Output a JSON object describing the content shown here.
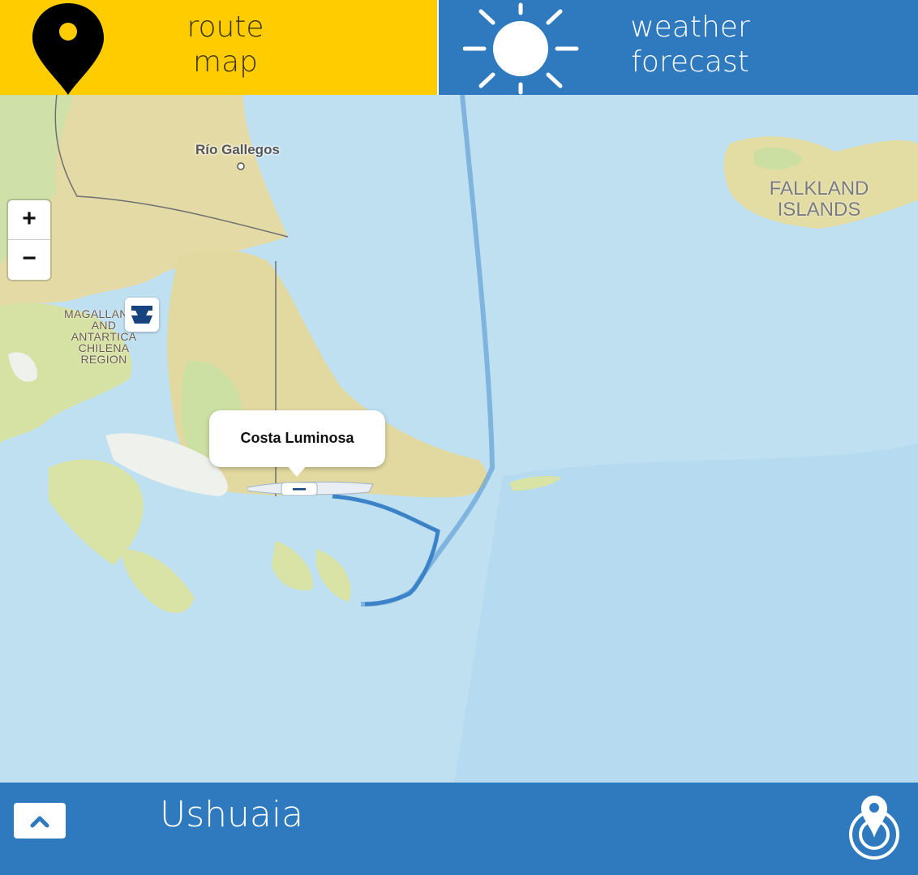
{
  "header": {
    "route_tab": {
      "line1": "route",
      "line2": "map",
      "icon": "map-pin-icon",
      "color": "#FFCC00"
    },
    "weather_tab": {
      "line1": "weather",
      "line2": "forecast",
      "icon": "sun-icon",
      "color": "#2F7ABF"
    }
  },
  "map": {
    "zoom_in": "+",
    "zoom_out": "−",
    "labels": {
      "rio_gallegos": "Río Gallegos",
      "region": [
        "MAGALLANES",
        "AND",
        "ANTARTICA",
        "CHILENA",
        "REGION"
      ],
      "falkland": [
        "FALKLAND",
        "ISLANDS"
      ]
    },
    "ship_popup": "Costa Luminosa",
    "route_color": "#4A8FD0",
    "water_color": "#BFE0F1",
    "land_color": "#E6DCA9"
  },
  "footer": {
    "port_name": "Ushuaia",
    "expand_icon": "chevron-up-icon",
    "locate_icon": "locate-pin-icon",
    "color": "#2F7ABF"
  }
}
